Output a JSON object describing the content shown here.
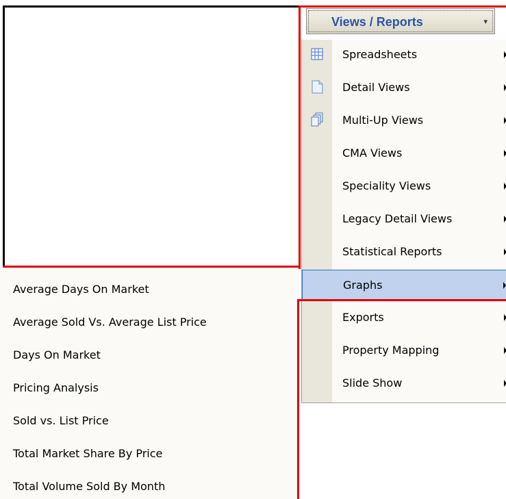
{
  "toolbar": {
    "views_reports_label": "Views / Reports",
    "dropdown_arrow": "▾"
  },
  "menu": {
    "items": [
      {
        "label": "Spreadsheets",
        "icon": "spreadsheet-icon"
      },
      {
        "label": "Detail Views",
        "icon": "document-icon"
      },
      {
        "label": "Multi-Up Views",
        "icon": "multi-document-icon"
      },
      {
        "label": "CMA Views"
      },
      {
        "label": "Speciality Views"
      },
      {
        "label": "Legacy Detail Views"
      },
      {
        "label": "Statistical Reports"
      },
      {
        "label": "Graphs",
        "highlighted": true
      },
      {
        "label": "Exports"
      },
      {
        "label": "Property Mapping"
      },
      {
        "label": "Slide Show"
      }
    ]
  },
  "graphs_submenu": {
    "items": [
      "Average Days On Market",
      "Average Sold Vs. Average List Price",
      "Days On Market",
      "Pricing Analysis",
      "Sold vs. List Price",
      "Total Market Share By Price",
      "Total Volume Sold By Month"
    ]
  },
  "colors": {
    "annotation_red": "#e00000",
    "highlight": "#c1d2ee",
    "toolbar_text": "#2a55a8"
  }
}
